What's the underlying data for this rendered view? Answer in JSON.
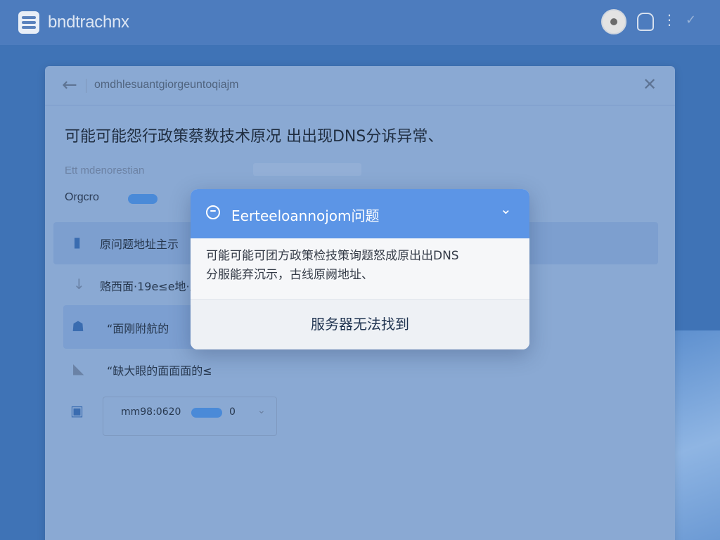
{
  "header": {
    "app_title": "bndtrachnx",
    "logo_icon": "app-logo-icon",
    "avatar_icon": "user-avatar-icon",
    "bag_icon": "shopping-bag-icon",
    "more_icon": "more-vertical-icon",
    "check_icon": "check-icon"
  },
  "panel": {
    "back_glyph": "←",
    "subtitle": "omdhlesuantgiorgeuntoqiajm",
    "close_glyph": "✕",
    "heading": "可能可能怨行政策蔡数技术原况  出出现DNS分诉异常、",
    "field_label": "Ett mdenorestian",
    "field_value": "Orgcro",
    "rows": [
      {
        "icon": "▮",
        "label": "原问题地址主示"
      },
      {
        "icon": "↓",
        "label": "赂西面·19e≤e地·息"
      },
      {
        "icon": "☗",
        "label": "“面刚附航的"
      },
      {
        "icon": "◣",
        "label": "“缺大眼的面面面的≤"
      },
      {
        "icon": "▣",
        "label": "mm98:0620"
      }
    ],
    "mini_value": "0",
    "mini_chevron": "⌄"
  },
  "popup": {
    "title": "Eerteeloannojom问题",
    "chevron": "⌄",
    "body_line1": "可能可能可团方政策检技策询题怒成原出出DNS",
    "body_line2": "分服能弃沉示，古线原阙地址、",
    "action_label": "服务器无法找到"
  },
  "colors": {
    "header_bg": "#4d7cbe",
    "popup_header": "#5c95e6",
    "accent_pill": "#4a8ad8"
  }
}
